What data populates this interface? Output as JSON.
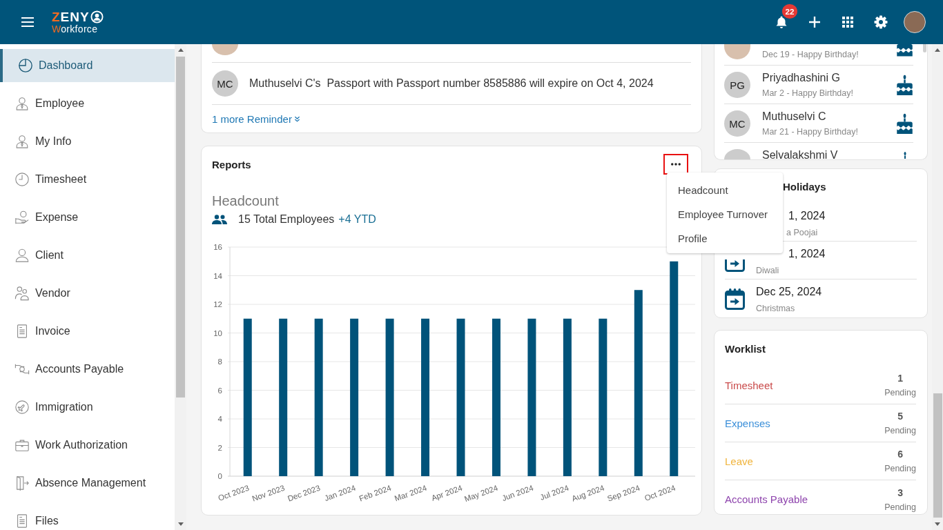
{
  "header": {
    "logo": {
      "name": "ZENY",
      "tagline": "Workforce"
    },
    "notifications": {
      "count": "22"
    }
  },
  "sidebar": {
    "items": [
      {
        "label": "Dashboard",
        "selected": true
      },
      {
        "label": "Employee",
        "selected": false
      },
      {
        "label": "My Info",
        "selected": false
      },
      {
        "label": "Timesheet",
        "selected": false
      },
      {
        "label": "Expense",
        "selected": false
      },
      {
        "label": "Client",
        "selected": false
      },
      {
        "label": "Vendor",
        "selected": false
      },
      {
        "label": "Invoice",
        "selected": false
      },
      {
        "label": "Accounts Payable",
        "selected": false
      },
      {
        "label": "Immigration",
        "selected": false
      },
      {
        "label": "Work Authorization",
        "selected": false
      },
      {
        "label": "Absence Management",
        "selected": false
      },
      {
        "label": "Files",
        "selected": false
      }
    ]
  },
  "reminders": {
    "items": [
      {
        "kind": "photocut"
      },
      {
        "kind": "initials",
        "initials": "MC",
        "text": "Muthuselvi C's  Passport with Passport number 8585886 will expire on Oct 4, 2024"
      }
    ],
    "more_link": "1 more Reminder"
  },
  "reports": {
    "title": "Reports",
    "more_button": {
      "highlighted": true
    },
    "menu": {
      "open": true,
      "items": [
        "Headcount",
        "Employee Turnover",
        "Profile"
      ]
    },
    "summary": {
      "total": "15 Total Employees",
      "change": "+4 YTD"
    },
    "chart_data": {
      "type": "bar",
      "title": "Headcount",
      "categories": [
        "Oct 2023",
        "Nov 2023",
        "Dec 2023",
        "Jan 2024",
        "Feb 2024",
        "Mar 2024",
        "Apr 2024",
        "May 2024",
        "Jun 2024",
        "Jul 2024",
        "Aug 2024",
        "Sep 2024",
        "Oct 2024"
      ],
      "values": [
        11,
        11,
        11,
        11,
        11,
        11,
        11,
        11,
        11,
        11,
        11,
        13,
        15
      ],
      "ylim": [
        0,
        16
      ],
      "yticks": [
        0,
        2,
        4,
        6,
        8,
        10,
        12,
        14,
        16
      ],
      "grid": true
    }
  },
  "birthdays": {
    "items": [
      {
        "kind": "photocut",
        "note": "Dec 19 - Happy Birthday!"
      },
      {
        "kind": "initials",
        "initials": "PG",
        "name": "Priyadhashini G",
        "note": "Mar 2 - Happy Birthday!"
      },
      {
        "kind": "initials",
        "initials": "MC",
        "name": "Muthuselvi C",
        "note": "Mar 21 - Happy Birthday!"
      },
      {
        "kind": "cutoff",
        "name": "Selvalakshmi V"
      }
    ]
  },
  "holidays": {
    "title": "Holidays",
    "title_covered": true,
    "items": [
      {
        "kind": "hidden",
        "date": "1, 2024",
        "name": "a Poojai"
      },
      {
        "kind": "lower",
        "date": "1, 2024",
        "name": "Diwali"
      },
      {
        "kind": "full",
        "date": "Dec 25, 2024",
        "name": "Christmas"
      }
    ]
  },
  "worklist": {
    "title": "Worklist",
    "items": [
      {
        "label": "Timesheet",
        "color": "#c94a4a",
        "count": "1",
        "status": "Pending"
      },
      {
        "label": "Expenses",
        "color": "#3b8fd9",
        "count": "5",
        "status": "Pending"
      },
      {
        "label": "Leave",
        "color": "#f0b43c",
        "count": "6",
        "status": "Pending"
      },
      {
        "label": "Accounts Payable",
        "color": "#8e44ad",
        "count": "3",
        "status": "Pending"
      }
    ]
  }
}
